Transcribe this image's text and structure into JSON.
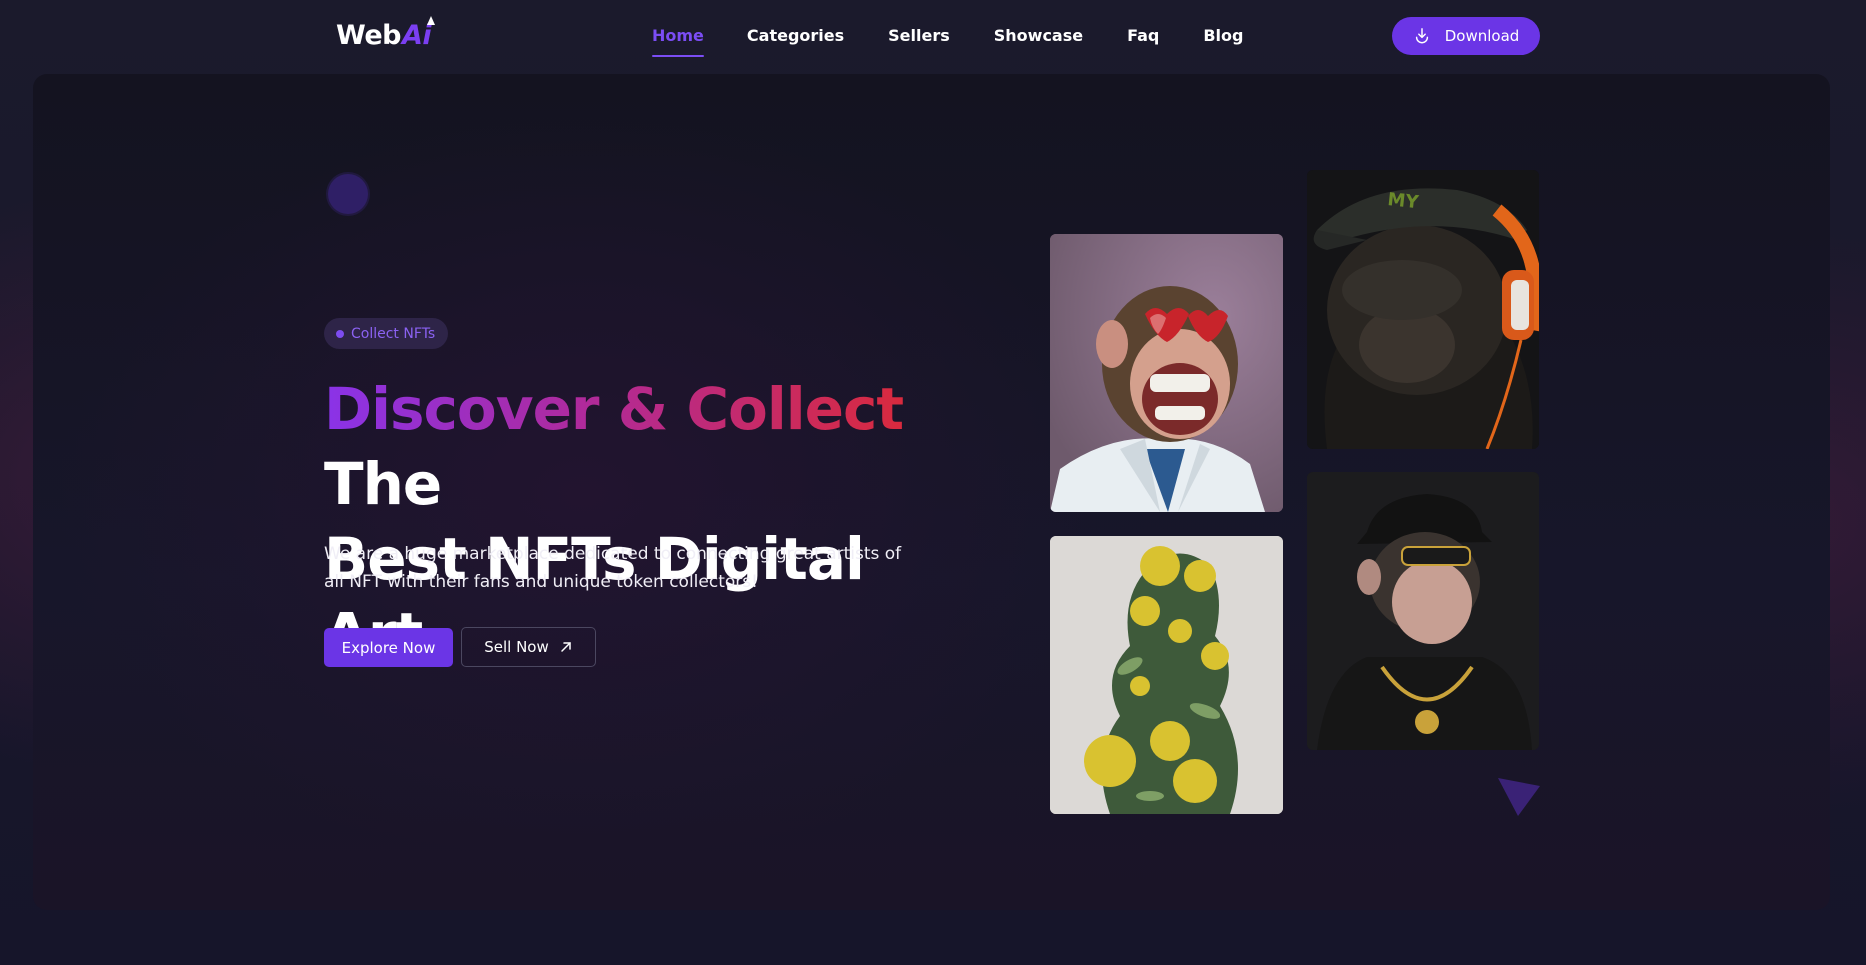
{
  "header": {
    "logo_main": "Web",
    "logo_accent": "Ai",
    "nav": [
      {
        "label": "Home",
        "active": true
      },
      {
        "label": "Categories",
        "active": false
      },
      {
        "label": "Sellers",
        "active": false
      },
      {
        "label": "Showcase",
        "active": false
      },
      {
        "label": "Faq",
        "active": false
      },
      {
        "label": "Blog",
        "active": false
      }
    ],
    "download_label": "Download",
    "download_icon": "download-icon"
  },
  "hero": {
    "badge": "Collect NFTs",
    "headline_gradient": "Discover & Collect",
    "headline_rest_1": " The",
    "headline_line2": "Best NFTs Digital Art",
    "lead": "We are a huge marketplace dedicated to connecting great artists of all NFT with their fans and unique token collectors!",
    "explore_label": "Explore Now",
    "sell_label": "Sell Now",
    "sell_icon": "arrow-up-right-icon"
  },
  "gallery": [
    {
      "name": "ape-heart-glasses-nft",
      "description_icon": "nft-artwork"
    },
    {
      "name": "flower-bust-nft",
      "description_icon": "nft-artwork"
    },
    {
      "name": "chimp-headphones-nft",
      "description_icon": "nft-artwork"
    },
    {
      "name": "ape-gold-chain-nft",
      "description_icon": "nft-artwork"
    }
  ],
  "colors": {
    "accent": "#6b35e6",
    "nav_active": "#7b4df5",
    "gradient_start": "#8a33e8",
    "gradient_end": "#d92a3e"
  }
}
